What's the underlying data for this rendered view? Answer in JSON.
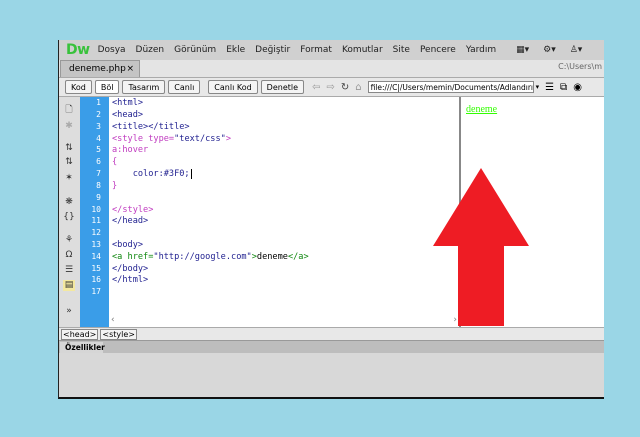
{
  "app": {
    "logo": "Dw"
  },
  "menu": [
    "Dosya",
    "Düzen",
    "Görünüm",
    "Ekle",
    "Değiştir",
    "Format",
    "Komutlar",
    "Site",
    "Pencere",
    "Yardım"
  ],
  "menu_icons": [
    "▦▾",
    "⚙▾",
    "♙▾"
  ],
  "tab": {
    "name": "deneme.php",
    "close": "×",
    "path": "C:\\Users\\m"
  },
  "toolbar": {
    "kod": "Kod",
    "bol": "Böl",
    "tasarim": "Tasarım",
    "canli": "Canlı",
    "canli_kod": "Canlı Kod",
    "denetle": "Denetle",
    "address": "file:///C|/Users/memin/Documents/Adlandırılma"
  },
  "left_icons": [
    "🗋",
    "✱",
    "⇅",
    "⇅",
    "✶",
    "❋",
    "{}",
    "⚘",
    "Ω",
    "☰",
    "▤",
    "»"
  ],
  "line_numbers": [
    "1",
    "2",
    "3",
    "4",
    "5",
    "6",
    "7",
    "8",
    "9",
    "10",
    "11",
    "12",
    "13",
    "14",
    "15",
    "16",
    "17"
  ],
  "code": {
    "l1": "<html>",
    "l2": "<head>",
    "l3": "<title></title>",
    "l4a": "<style type=",
    "l4b": "\"text/css\"",
    "l4c": ">",
    "l5": "a:hover",
    "l6": "{",
    "l7": "    color:#3F0;",
    "l8": "}",
    "l10": "</style>",
    "l11": "</head>",
    "l13": "<body>",
    "l14a": "<a href=",
    "l14b": "\"http://google.com\"",
    "l14c": ">",
    "l14d": "deneme",
    "l14e": "</a>",
    "l15": "</body>",
    "l16": "</html>"
  },
  "live_view": {
    "link_text": "deneme",
    "arrow_color": "#ee1c24",
    "link_color": "#33ff00"
  },
  "status": {
    "crumb1": "<head>",
    "crumb2": "<style>"
  },
  "properties": {
    "tab": "Özellikler"
  }
}
